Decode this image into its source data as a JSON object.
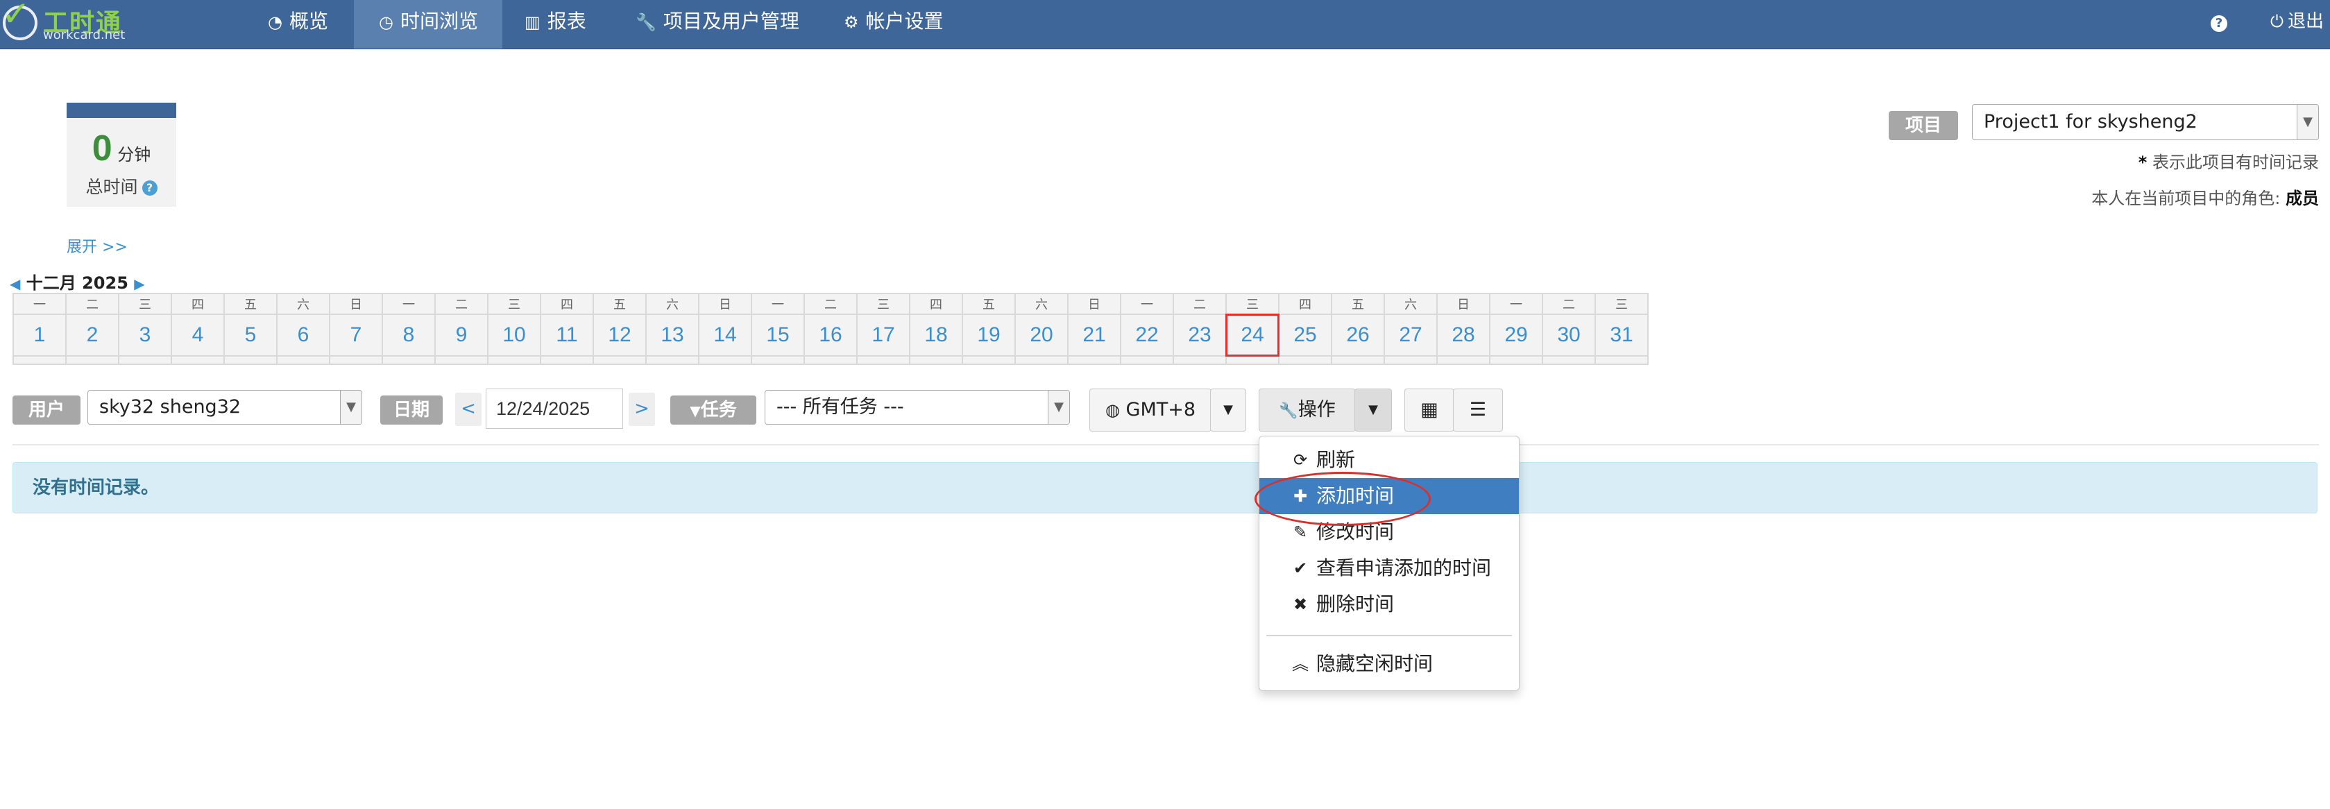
{
  "nav": {
    "logo_text": "工时通",
    "logo_sub": "workcard.net",
    "items": [
      {
        "label": "概览",
        "icon": "dashboard-icon"
      },
      {
        "label": "时间浏览",
        "icon": "clock-icon"
      },
      {
        "label": "报表",
        "icon": "bar-chart-icon"
      },
      {
        "label": "项目及用户管理",
        "icon": "wrench-icon"
      },
      {
        "label": "帐户设置",
        "icon": "gear-icon"
      }
    ],
    "help_icon": "question-icon",
    "logout_label": "退出"
  },
  "summary": {
    "total_value": "0",
    "total_unit": "分钟",
    "total_label": "总时间",
    "expand_label": "展开 >>"
  },
  "project": {
    "label": "项目",
    "selected": "Project1 for skysheng2",
    "note_star": "*",
    "note_text": "表示此项目有时间记录",
    "role_prefix": "本人在当前项目中的角色:",
    "role_value": "成员"
  },
  "calendar": {
    "month_label": "十二月 2025",
    "weekdays": [
      "一",
      "二",
      "三",
      "四",
      "五",
      "六",
      "日",
      "一",
      "二",
      "三",
      "四",
      "五",
      "六",
      "日",
      "一",
      "二",
      "三",
      "四",
      "五",
      "六",
      "日",
      "一",
      "二",
      "三",
      "四",
      "五",
      "六",
      "日",
      "一",
      "二",
      "三"
    ],
    "days": [
      "1",
      "2",
      "3",
      "4",
      "5",
      "6",
      "7",
      "8",
      "9",
      "10",
      "11",
      "12",
      "13",
      "14",
      "15",
      "16",
      "17",
      "18",
      "19",
      "20",
      "21",
      "22",
      "23",
      "24",
      "25",
      "26",
      "27",
      "28",
      "29",
      "30",
      "31"
    ],
    "today": "24"
  },
  "filters": {
    "user_label": "用户",
    "user_value": "sky32 sheng32",
    "date_label": "日期",
    "prev": "<",
    "date_value": "12/24/2025",
    "next": ">",
    "task_label": "任务",
    "task_value": "--- 所有任务 ---",
    "timezone": "GMT+8",
    "operate_label": "操作"
  },
  "alert": {
    "text": "没有时间记录。"
  },
  "dropdown": {
    "items": [
      {
        "label": "刷新",
        "icon": "refresh-icon"
      },
      {
        "label": "添加时间",
        "icon": "plus-icon"
      },
      {
        "label": "修改时间",
        "icon": "edit-icon"
      },
      {
        "label": "查看申请添加的时间",
        "icon": "check-circle-icon"
      },
      {
        "label": "删除时间",
        "icon": "x-icon"
      },
      {
        "label": "隐藏空闲时间",
        "icon": "double-chevron-up-icon"
      }
    ]
  },
  "colors": {
    "navbar": "#3f6699",
    "active_nav": "#5a80b0",
    "link": "#3a8fd0",
    "highlight": "#3f7fc1",
    "annotation": "#d9302c"
  }
}
